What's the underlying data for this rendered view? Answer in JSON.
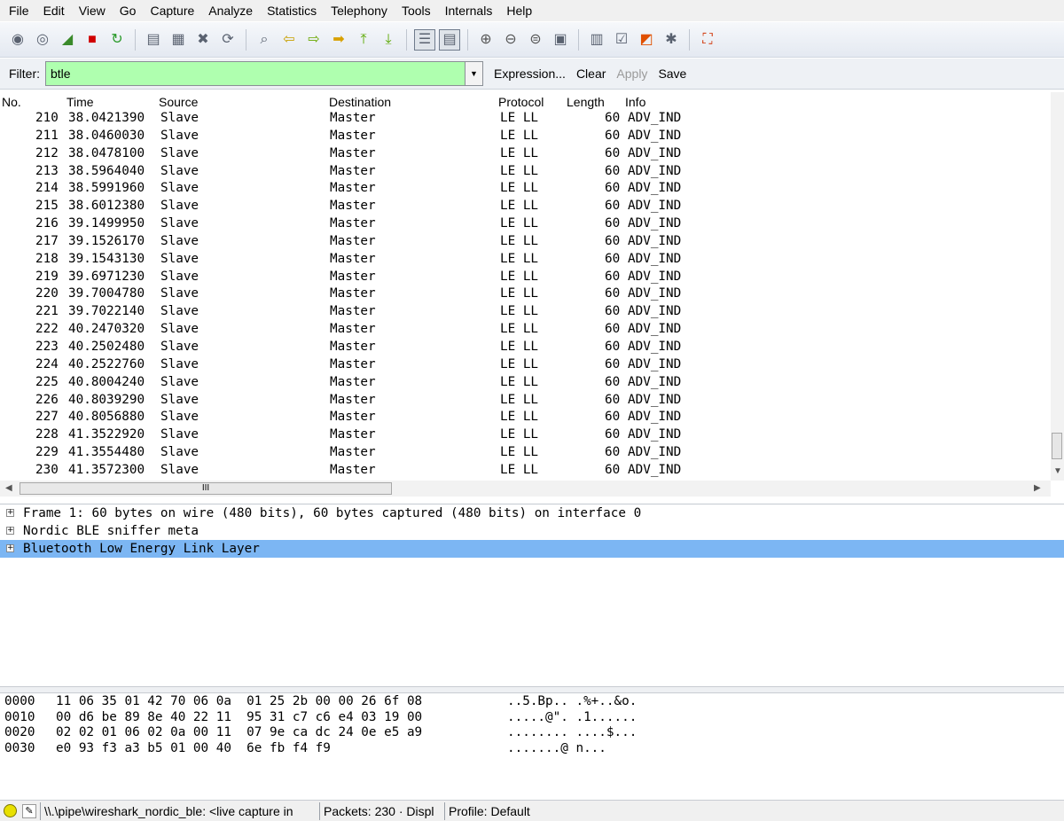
{
  "menu": [
    "File",
    "Edit",
    "View",
    "Go",
    "Capture",
    "Analyze",
    "Statistics",
    "Telephony",
    "Tools",
    "Internals",
    "Help"
  ],
  "toolbar_icons": [
    "interfaces-icon",
    "options-icon",
    "start-capture-icon",
    "stop-capture-icon",
    "restart-capture-icon",
    "open-file-icon",
    "save-file-icon",
    "close-file-icon",
    "reload-icon",
    "find-packet-icon",
    "go-back-icon",
    "go-forward-icon",
    "go-to-packet-icon",
    "go-first-icon",
    "go-last-icon",
    "colorize-icon",
    "auto-scroll-icon",
    "zoom-in-icon",
    "zoom-out-icon",
    "normal-size-icon",
    "resize-columns-icon",
    "capture-filters-icon",
    "display-filters-icon",
    "coloring-rules-icon",
    "preferences-icon",
    "help-icon"
  ],
  "filter": {
    "label": "Filter:",
    "value": "btle",
    "expression": "Expression...",
    "clear": "Clear",
    "apply": "Apply",
    "save": "Save",
    "color": "#afffaf"
  },
  "columns": [
    "No.",
    "Time",
    "Source",
    "Destination",
    "Protocol",
    "Length",
    "Info"
  ],
  "packets": [
    {
      "no": "210",
      "time": "38.0421390",
      "src": "Slave",
      "dst": "Master",
      "proto": "LE LL",
      "len": "60",
      "info": "ADV_IND"
    },
    {
      "no": "211",
      "time": "38.0460030",
      "src": "Slave",
      "dst": "Master",
      "proto": "LE LL",
      "len": "60",
      "info": "ADV_IND"
    },
    {
      "no": "212",
      "time": "38.0478100",
      "src": "Slave",
      "dst": "Master",
      "proto": "LE LL",
      "len": "60",
      "info": "ADV_IND"
    },
    {
      "no": "213",
      "time": "38.5964040",
      "src": "Slave",
      "dst": "Master",
      "proto": "LE LL",
      "len": "60",
      "info": "ADV_IND"
    },
    {
      "no": "214",
      "time": "38.5991960",
      "src": "Slave",
      "dst": "Master",
      "proto": "LE LL",
      "len": "60",
      "info": "ADV_IND"
    },
    {
      "no": "215",
      "time": "38.6012380",
      "src": "Slave",
      "dst": "Master",
      "proto": "LE LL",
      "len": "60",
      "info": "ADV_IND"
    },
    {
      "no": "216",
      "time": "39.1499950",
      "src": "Slave",
      "dst": "Master",
      "proto": "LE LL",
      "len": "60",
      "info": "ADV_IND"
    },
    {
      "no": "217",
      "time": "39.1526170",
      "src": "Slave",
      "dst": "Master",
      "proto": "LE LL",
      "len": "60",
      "info": "ADV_IND"
    },
    {
      "no": "218",
      "time": "39.1543130",
      "src": "Slave",
      "dst": "Master",
      "proto": "LE LL",
      "len": "60",
      "info": "ADV_IND"
    },
    {
      "no": "219",
      "time": "39.6971230",
      "src": "Slave",
      "dst": "Master",
      "proto": "LE LL",
      "len": "60",
      "info": "ADV_IND"
    },
    {
      "no": "220",
      "time": "39.7004780",
      "src": "Slave",
      "dst": "Master",
      "proto": "LE LL",
      "len": "60",
      "info": "ADV_IND"
    },
    {
      "no": "221",
      "time": "39.7022140",
      "src": "Slave",
      "dst": "Master",
      "proto": "LE LL",
      "len": "60",
      "info": "ADV_IND"
    },
    {
      "no": "222",
      "time": "40.2470320",
      "src": "Slave",
      "dst": "Master",
      "proto": "LE LL",
      "len": "60",
      "info": "ADV_IND"
    },
    {
      "no": "223",
      "time": "40.2502480",
      "src": "Slave",
      "dst": "Master",
      "proto": "LE LL",
      "len": "60",
      "info": "ADV_IND"
    },
    {
      "no": "224",
      "time": "40.2522760",
      "src": "Slave",
      "dst": "Master",
      "proto": "LE LL",
      "len": "60",
      "info": "ADV_IND"
    },
    {
      "no": "225",
      "time": "40.8004240",
      "src": "Slave",
      "dst": "Master",
      "proto": "LE LL",
      "len": "60",
      "info": "ADV_IND"
    },
    {
      "no": "226",
      "time": "40.8039290",
      "src": "Slave",
      "dst": "Master",
      "proto": "LE LL",
      "len": "60",
      "info": "ADV_IND"
    },
    {
      "no": "227",
      "time": "40.8056880",
      "src": "Slave",
      "dst": "Master",
      "proto": "LE LL",
      "len": "60",
      "info": "ADV_IND"
    },
    {
      "no": "228",
      "time": "41.3522920",
      "src": "Slave",
      "dst": "Master",
      "proto": "LE LL",
      "len": "60",
      "info": "ADV_IND"
    },
    {
      "no": "229",
      "time": "41.3554480",
      "src": "Slave",
      "dst": "Master",
      "proto": "LE LL",
      "len": "60",
      "info": "ADV_IND"
    },
    {
      "no": "230",
      "time": "41.3572300",
      "src": "Slave",
      "dst": "Master",
      "proto": "LE LL",
      "len": "60",
      "info": "ADV_IND"
    }
  ],
  "details": [
    {
      "text": "Frame 1: 60 bytes on wire (480 bits), 60 bytes captured (480 bits) on interface 0",
      "selected": false
    },
    {
      "text": "Nordic BLE sniffer meta",
      "selected": false
    },
    {
      "text": "Bluetooth Low Energy Link Layer",
      "selected": true
    }
  ],
  "selected_color": "#7cb6f3",
  "hex": [
    {
      "offset": "0000",
      "bytes": "11 06 35 01 42 70 06 0a  01 25 2b 00 00 26 6f 08",
      "ascii": "..5.Bp.. .%+..&o."
    },
    {
      "offset": "0010",
      "bytes": "00 d6 be 89 8e 40 22 11  95 31 c7 c6 e4 03 19 00",
      "ascii": ".....@\". .1......"
    },
    {
      "offset": "0020",
      "bytes": "02 02 01 06 02 0a 00 11  07 9e ca dc 24 0e e5 a9",
      "ascii": "........ ....$..."
    },
    {
      "offset": "0030",
      "bytes": "e0 93 f3 a3 b5 01 00 40  6e fb f4 f9",
      "ascii": ".......@ n..."
    }
  ],
  "status": {
    "capture": "\\\\.\\pipe\\wireshark_nordic_ble: <live capture in",
    "packets": "Packets: 230 · Displ",
    "profile": "Profile: Default"
  },
  "hscroll_grip": "III"
}
